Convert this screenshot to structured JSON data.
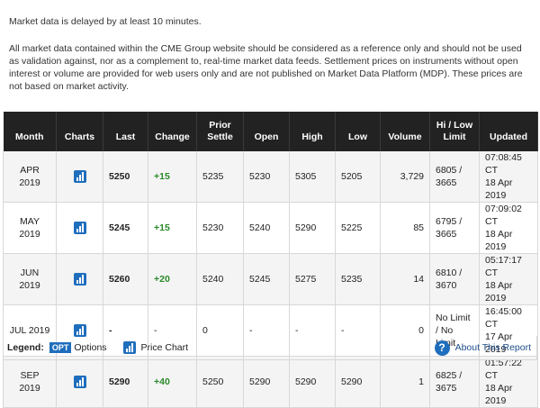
{
  "notice": {
    "delay": "Market data is delayed by at least 10 minutes.",
    "disclaimer": "All market data contained within the CME Group website should be considered as a reference only and should not be used as validation against, nor as a complement to, real-time market data feeds. Settlement prices on instruments without open interest or volume are provided for web users only and are not published on Market Data Platform (MDP). These prices are not based on market activity."
  },
  "table": {
    "headers": {
      "month": "Month",
      "charts": "Charts",
      "last": "Last",
      "change": "Change",
      "prior_settle_1": "Prior",
      "prior_settle_2": "Settle",
      "open": "Open",
      "high": "High",
      "low": "Low",
      "volume": "Volume",
      "hilo_1": "Hi / Low",
      "hilo_2": "Limit",
      "updated": "Updated"
    },
    "rows": [
      {
        "month": "APR 2019",
        "last": "5250",
        "change": "+15",
        "prior_settle": "5235",
        "open": "5230",
        "high": "5305",
        "low": "5205",
        "volume": "3,729",
        "hilo_1": "6805 /",
        "hilo_2": "3665",
        "hilo_3": "",
        "updated_time": "07:08:45 CT",
        "updated_date": "18 Apr 2019"
      },
      {
        "month": "MAY 2019",
        "last": "5245",
        "change": "+15",
        "prior_settle": "5230",
        "open": "5240",
        "high": "5290",
        "low": "5225",
        "volume": "85",
        "hilo_1": "6795 /",
        "hilo_2": "3665",
        "hilo_3": "",
        "updated_time": "07:09:02 CT",
        "updated_date": "18 Apr 2019"
      },
      {
        "month": "JUN 2019",
        "last": "5260",
        "change": "+20",
        "prior_settle": "5240",
        "open": "5245",
        "high": "5275",
        "low": "5235",
        "volume": "14",
        "hilo_1": "6810 /",
        "hilo_2": "3670",
        "hilo_3": "",
        "updated_time": "05:17:17 CT",
        "updated_date": "18 Apr 2019"
      },
      {
        "month": "JUL 2019",
        "last": "-",
        "change": "-",
        "prior_settle": "0",
        "open": "-",
        "high": "-",
        "low": "-",
        "volume": "0",
        "hilo_1": "No Limit",
        "hilo_2": "/ No",
        "hilo_3": "Limit",
        "updated_time": "16:45:00 CT",
        "updated_date": "17 Apr 2019"
      },
      {
        "month": "SEP 2019",
        "last": "5290",
        "change": "+40",
        "prior_settle": "5250",
        "open": "5290",
        "high": "5290",
        "low": "5290",
        "volume": "1",
        "hilo_1": "6825 /",
        "hilo_2": "3675",
        "hilo_3": "",
        "updated_time": "01:57:22 CT",
        "updated_date": "18 Apr 2019"
      }
    ]
  },
  "legend": {
    "label": "Legend:",
    "opt_badge": "OPT",
    "options_label": "Options",
    "price_chart_label": "Price Chart",
    "about_label": "About This Report"
  },
  "colors": {
    "header_bg": "#222222",
    "accent_blue": "#1f6ebd",
    "positive_green": "#2a8a2a"
  }
}
